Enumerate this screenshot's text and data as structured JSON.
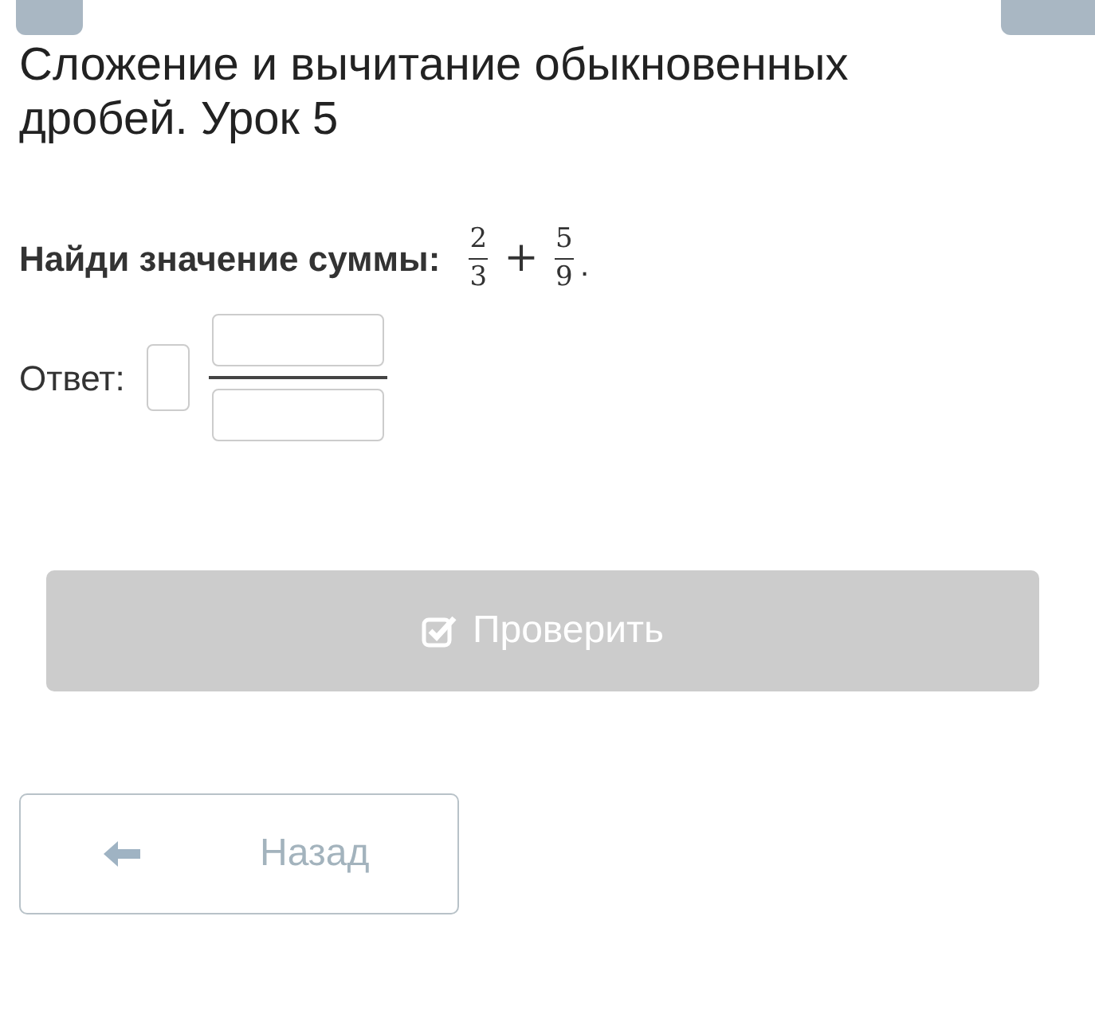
{
  "title": "Сложение и вычитание обыкновенных дробей. Урок 5",
  "problem": {
    "label": "Найди значение суммы:",
    "terms": [
      {
        "numerator": "2",
        "denominator": "3"
      },
      {
        "numerator": "5",
        "denominator": "9"
      }
    ],
    "operator": "+",
    "end": "."
  },
  "answer": {
    "label": "Ответ:"
  },
  "check_button": {
    "label": "Проверить",
    "disabled": true
  },
  "back_button": {
    "label": "Назад"
  }
}
